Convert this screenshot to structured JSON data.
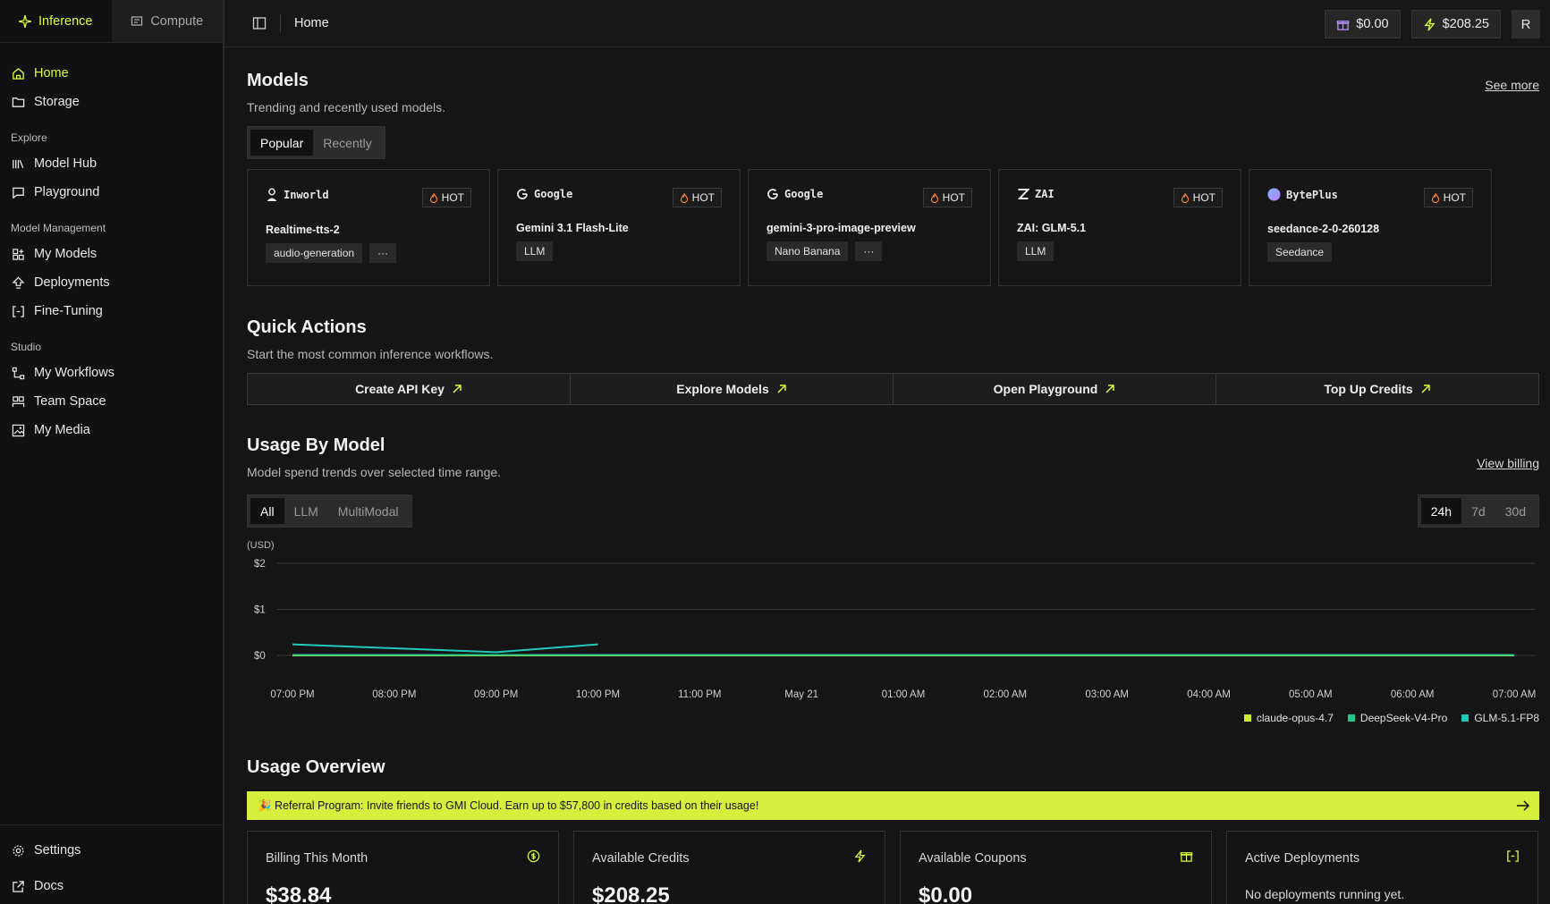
{
  "sidebar": {
    "tabs": [
      {
        "label": "Inference",
        "icon": "sparkle-icon"
      },
      {
        "label": "Compute",
        "icon": "cpu-icon"
      }
    ],
    "primary": [
      {
        "label": "Home",
        "icon": "home-icon"
      },
      {
        "label": "Storage",
        "icon": "folder-icon"
      }
    ],
    "sections": [
      {
        "title": "Explore",
        "items": [
          {
            "label": "Model Hub",
            "icon": "library-icon"
          },
          {
            "label": "Playground",
            "icon": "chat-icon"
          }
        ]
      },
      {
        "title": "Model Management",
        "items": [
          {
            "label": "My Models",
            "icon": "grid-plus-icon"
          },
          {
            "label": "Deployments",
            "icon": "upload-icon"
          },
          {
            "label": "Fine-Tuning",
            "icon": "brackets-icon"
          }
        ]
      },
      {
        "title": "Studio",
        "items": [
          {
            "label": "My Workflows",
            "icon": "workflow-icon"
          },
          {
            "label": "Team Space",
            "icon": "team-icon"
          },
          {
            "label": "My Media",
            "icon": "media-icon"
          }
        ]
      }
    ],
    "bottom": [
      {
        "label": "Settings",
        "icon": "gear-icon"
      },
      {
        "label": "Docs",
        "icon": "external-link-icon"
      }
    ]
  },
  "header": {
    "breadcrumb": "Home",
    "coupons": "$0.00",
    "credits": "$208.25",
    "avatar": "R"
  },
  "models": {
    "title": "Models",
    "subtitle": "Trending and recently used models.",
    "see_more": "See more",
    "tabs": [
      "Popular",
      "Recently"
    ],
    "hot_label": "HOT",
    "cards": [
      {
        "brand": "Inworld",
        "name": "Realtime-tts-2",
        "tags": [
          "audio-generation",
          "···"
        ]
      },
      {
        "brand": "Google",
        "name": "Gemini 3.1 Flash-Lite",
        "tags": [
          "LLM"
        ]
      },
      {
        "brand": "Google",
        "name": "gemini-3-pro-image-preview",
        "tags": [
          "Nano Banana",
          "···"
        ]
      },
      {
        "brand": "ZAI",
        "name": "ZAI: GLM-5.1",
        "tags": [
          "LLM"
        ]
      },
      {
        "brand": "BytePlus",
        "name": "seedance-2-0-260128",
        "tags": [
          "Seedance"
        ]
      }
    ]
  },
  "quick_actions": {
    "title": "Quick Actions",
    "subtitle": "Start the most common inference workflows.",
    "buttons": [
      "Create API Key",
      "Explore Models",
      "Open Playground",
      "Top Up Credits"
    ]
  },
  "usage": {
    "title": "Usage By Model",
    "subtitle": "Model spend trends over selected time range.",
    "view_billing": "View billing",
    "filters": [
      "All",
      "LLM",
      "MultiModal"
    ],
    "ranges": [
      "24h",
      "7d",
      "30d"
    ]
  },
  "chart_data": {
    "type": "line",
    "ylabel": "(USD)",
    "y_ticks": [
      "$0",
      "$1",
      "$2"
    ],
    "ylim": [
      0,
      2
    ],
    "categories": [
      "07:00 PM",
      "08:00 PM",
      "09:00 PM",
      "10:00 PM",
      "11:00 PM",
      "May 21",
      "01:00 AM",
      "02:00 AM",
      "03:00 AM",
      "04:00 AM",
      "05:00 AM",
      "06:00 AM",
      "07:00 AM"
    ],
    "series": [
      {
        "name": "claude-opus-4.7",
        "color": "#c6e82e",
        "points": [
          [
            0,
            0.0
          ],
          [
            12,
            0.0
          ]
        ]
      },
      {
        "name": "DeepSeek-V4-Pro",
        "color": "#22c88a",
        "points": [
          [
            0,
            0.0
          ],
          [
            12,
            0.0
          ]
        ]
      },
      {
        "name": "GLM-5.1-FP8",
        "color": "#1fc9b8",
        "points": [
          [
            0,
            0.22
          ],
          [
            2,
            0.05
          ],
          [
            3,
            0.22
          ]
        ]
      }
    ],
    "legend_position": "bottom-right",
    "grid": true
  },
  "overview": {
    "title": "Usage Overview",
    "banner": "🎉 Referral Program: Invite friends to GMI Cloud. Earn up to $57,800 in credits based on their usage!",
    "stats": [
      {
        "label": "Billing This Month",
        "value": "$38.84",
        "icon": "dollar-icon"
      },
      {
        "label": "Available Credits",
        "value": "$208.25",
        "icon": "bolt-icon"
      },
      {
        "label": "Available Coupons",
        "value": "$0.00",
        "icon": "gift-icon"
      },
      {
        "label": "Active Deployments",
        "note": "No deployments running yet.",
        "icon": "brackets-icon"
      }
    ]
  },
  "colors": {
    "accent": "#d6ff3a",
    "background": "#151515",
    "banner": "#d6ee3c"
  }
}
